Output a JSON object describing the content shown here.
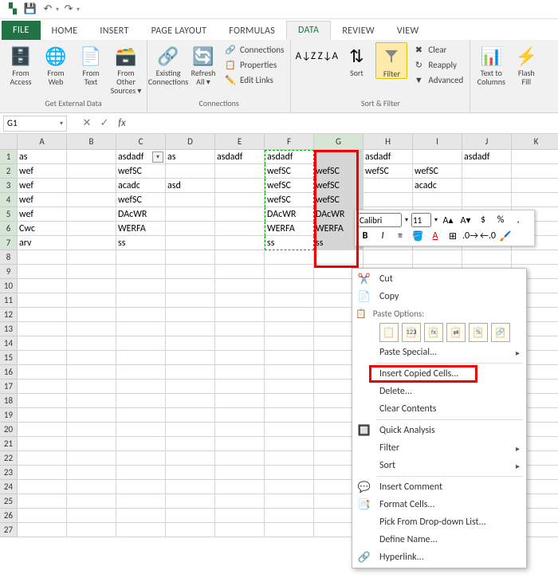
{
  "tabs": {
    "file": "FILE",
    "home": "HOME",
    "insert": "INSERT",
    "page_layout": "PAGE LAYOUT",
    "formulas": "FORMULAS",
    "data": "DATA",
    "review": "REVIEW",
    "view": "VIEW"
  },
  "ribbon": {
    "get_external": {
      "label": "Get External Data",
      "from_access": "From\nAccess",
      "from_web": "From\nWeb",
      "from_text": "From\nText",
      "from_other": "From Other\nSources ▾"
    },
    "connections": {
      "label": "Connections",
      "existing": "Existing\nConnections",
      "refresh": "Refresh\nAll ▾",
      "connections": "Connections",
      "properties": "Properties",
      "edit_links": "Edit Links"
    },
    "sort_filter": {
      "label": "Sort & Filter",
      "sort": "Sort",
      "filter": "Filter",
      "clear": "Clear",
      "reapply": "Reapply",
      "advanced": "Advanced"
    },
    "data_tools": {
      "text_to_columns": "Text to\nColumns",
      "flash_fill": "Flash\nFill"
    }
  },
  "namebox": "G1",
  "columns": [
    "A",
    "B",
    "C",
    "D",
    "E",
    "F",
    "G",
    "H",
    "I",
    "J",
    "K"
  ],
  "rows": 27,
  "cells": {
    "r1": {
      "A": "as",
      "C": "asdadf",
      "D": "as",
      "E": "asdadf",
      "F": "asdadf",
      "H": "asdadf",
      "J": "asdadf"
    },
    "r2": {
      "A": "wef",
      "C": "wefSC",
      "F": "wefSC",
      "G": "wefSC",
      "H": "wefSC",
      "I": "wefSC"
    },
    "r3": {
      "A": "wef",
      "C": "acadc",
      "D": "asd",
      "F": "wefSC",
      "G": "wefSC",
      "I": "acadc"
    },
    "r4": {
      "A": "wef",
      "C": "wefSC",
      "F": "wefSC",
      "G": "wefSC"
    },
    "r5": {
      "A": "wef",
      "C": "DAcWR",
      "F": "DAcWR",
      "G": "DAcWR"
    },
    "r6": {
      "A": "Cwc",
      "C": "WERFA",
      "F": "WERFA",
      "G": "WERFA"
    },
    "r7": {
      "A": "arv",
      "C": "ss",
      "F": "ss",
      "G": "ss"
    }
  },
  "minitb": {
    "font": "Calibri",
    "size": "11"
  },
  "ctx": {
    "cut": "Cut",
    "copy": "Copy",
    "paste_options": "Paste Options:",
    "paste_special": "Paste Special...",
    "insert_copied": "Insert Copied Cells...",
    "delete": "Delete...",
    "clear": "Clear Contents",
    "quick": "Quick Analysis",
    "filter": "Filter",
    "sort": "Sort",
    "insert_comment": "Insert Comment",
    "format_cells": "Format Cells...",
    "pick": "Pick From Drop-down List...",
    "define_name": "Define Name...",
    "hyperlink": "Hyperlink..."
  }
}
